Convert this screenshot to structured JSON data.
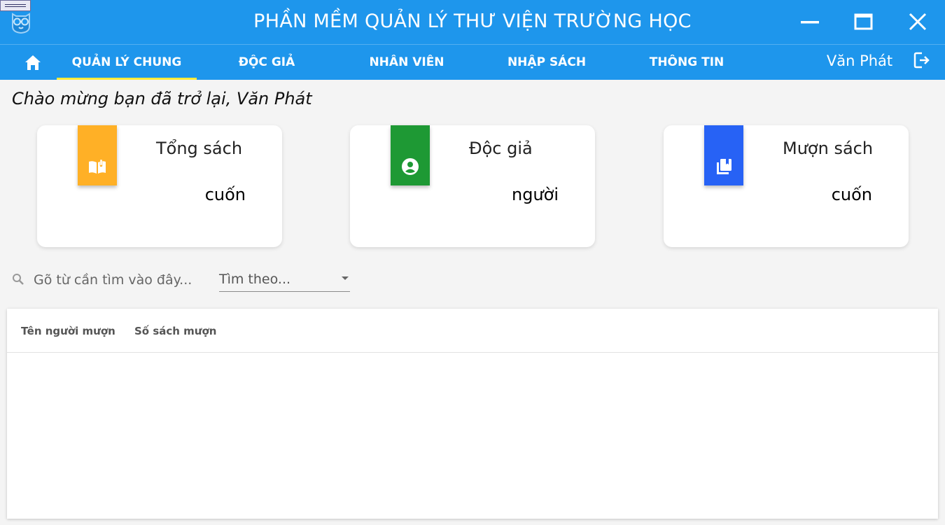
{
  "window": {
    "title": "PHẦN MỀM QUẢN LÝ THƯ VIỆN TRƯỜNG HỌC"
  },
  "nav": {
    "home_icon": "home-icon",
    "tabs": [
      {
        "label": "QUẢN LÝ CHUNG",
        "active": true
      },
      {
        "label": "ĐỘC GIẢ",
        "active": false
      },
      {
        "label": "NHÂN VIÊN",
        "active": false
      },
      {
        "label": "NHẬP SÁCH",
        "active": false
      },
      {
        "label": "THÔNG TIN",
        "active": false
      }
    ],
    "user_name": "Văn Phát",
    "logout_icon": "logout-icon",
    "active_indicator_color": "#ffeb3b"
  },
  "greeting": "Chào mừng bạn đã trở lại, Văn Phát",
  "cards": [
    {
      "label": "Tổng sách",
      "unit": "cuốn",
      "color": "#ffb026",
      "icon": "open-book-icon"
    },
    {
      "label": "Độc giả",
      "unit": "người",
      "color": "#1e9934",
      "icon": "account-circle-icon"
    },
    {
      "label": "Mượn sách",
      "unit": "cuốn",
      "color": "#2762f5",
      "icon": "library-books-icon"
    }
  ],
  "search": {
    "placeholder": "Gõ từ cần tìm vào đây...",
    "value": "",
    "filter_placeholder": "Tìm theo..."
  },
  "table": {
    "columns": [
      "Tên người mượn",
      "Số sách mượn"
    ],
    "rows": []
  },
  "colors": {
    "primary": "#1e96ec",
    "background": "#f4f4f4"
  }
}
